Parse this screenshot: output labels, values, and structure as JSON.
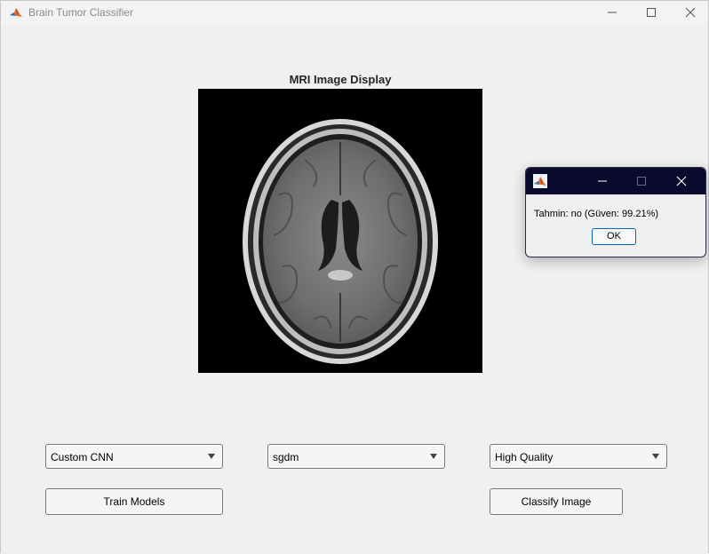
{
  "window": {
    "title": "Brain Tumor Classifier",
    "icon": "matlab-icon",
    "controls": [
      "minimize-icon",
      "maximize-icon",
      "close-icon"
    ]
  },
  "axes": {
    "title": "MRI Image Display",
    "image": "brain-mri-axial-scan"
  },
  "controls": {
    "model_dropdown": {
      "value": "Custom CNN"
    },
    "optimizer_dropdown": {
      "value": "sgdm"
    },
    "quality_dropdown": {
      "value": "High Quality"
    },
    "train_button": "Train Models",
    "classify_button": "Classify Image"
  },
  "dialog": {
    "title": "",
    "message": "Tahmin: no (Güven: 99.21%)",
    "ok_label": "OK",
    "titlebar_color": "#0a0a2e",
    "ok_border_color": "#0067c0"
  }
}
